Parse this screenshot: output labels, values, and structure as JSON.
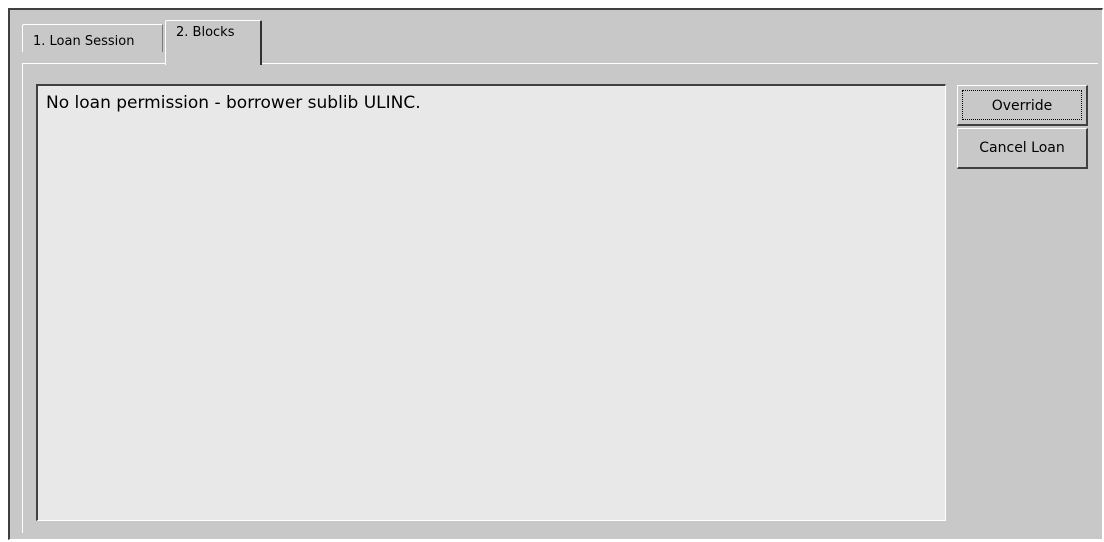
{
  "tabs": [
    {
      "label": "1. Loan Session",
      "active": false
    },
    {
      "label": "2. Blocks",
      "active": true
    }
  ],
  "message": {
    "text": "No loan permission - borrower sublib ULINC."
  },
  "buttons": {
    "override_label": "Override",
    "cancel_loan_label": "Cancel Loan"
  },
  "colors": {
    "window_bg": "#c8c8c8",
    "message_bg": "#e8e8e8"
  }
}
